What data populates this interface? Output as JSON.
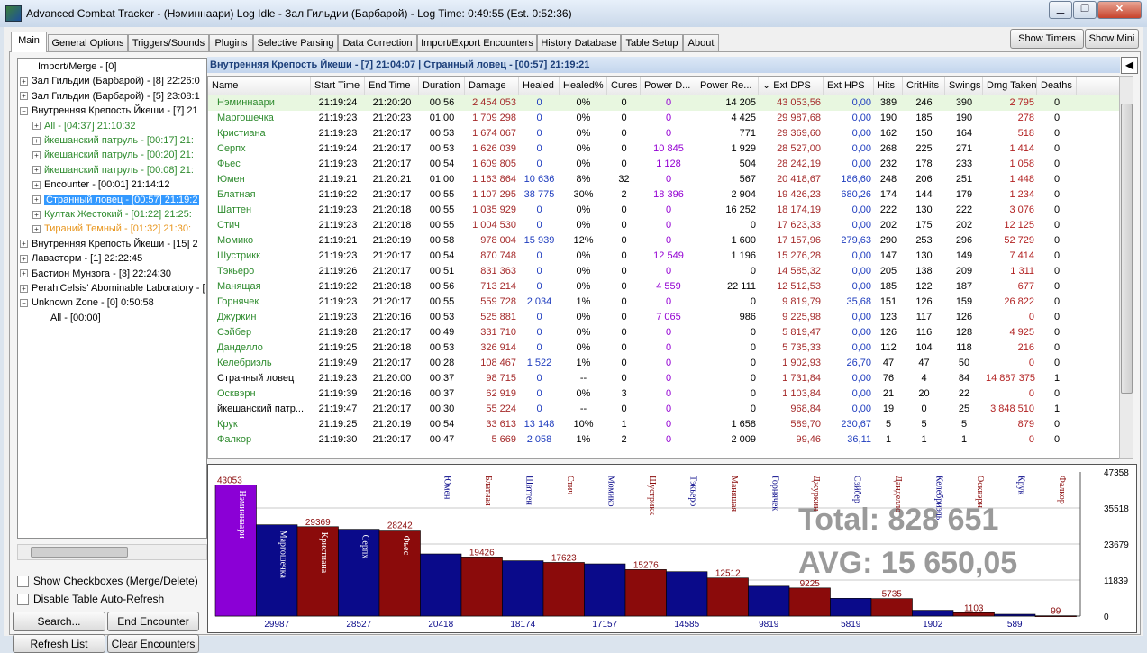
{
  "window": {
    "title": "Advanced Combat Tracker - (Нэминнаари) Log Idle - Зал Гильдии (Барбарой) - Log Time: 0:49:55 (Est. 0:52:36)",
    "min": "▁",
    "max": "❐",
    "close": "✕"
  },
  "tabs": [
    {
      "label": "Main"
    },
    {
      "label": "General Options"
    },
    {
      "label": "Triggers/Sounds"
    },
    {
      "label": "Plugins"
    },
    {
      "label": "Selective Parsing"
    },
    {
      "label": "Data Correction"
    },
    {
      "label": "Import/Export Encounters"
    },
    {
      "label": "History Database"
    },
    {
      "label": "Table Setup"
    },
    {
      "label": "About"
    }
  ],
  "top_buttons": {
    "show_timers": "Show Timers",
    "show_mini": "Show Mini"
  },
  "tree": [
    {
      "text": "Import/Merge - [0]",
      "level": 0,
      "expander": "",
      "color": "#000000"
    },
    {
      "text": "Зал Гильдии (Барбарой) - [8] 22:26:0",
      "level": 0,
      "expander": "+",
      "color": "#000000"
    },
    {
      "text": "Зал Гильдии (Барбарой) - [5] 23:08:1",
      "level": 0,
      "expander": "+",
      "color": "#000000"
    },
    {
      "text": "Внутренняя Крепость Йкеши - [7] 21",
      "level": 0,
      "expander": "−",
      "color": "#000000"
    },
    {
      "text": "All - [04:37] 21:10:32",
      "level": 1,
      "expander": "+",
      "color": "#2e8b2e"
    },
    {
      "text": "йкешанский патруль - [00:17] 21:",
      "level": 1,
      "expander": "+",
      "color": "#2e8b2e"
    },
    {
      "text": "йкешанский патруль - [00:20] 21:",
      "level": 1,
      "expander": "+",
      "color": "#2e8b2e"
    },
    {
      "text": "йкешанский патруль - [00:08] 21:",
      "level": 1,
      "expander": "+",
      "color": "#2e8b2e"
    },
    {
      "text": "Encounter - [00:01] 21:14:12",
      "level": 1,
      "expander": "+",
      "color": "#000000"
    },
    {
      "text": "Странный ловец - [00:57] 21:19:2",
      "level": 1,
      "expander": "+",
      "color": "#ffffff",
      "selected": true
    },
    {
      "text": "Култак Жестокий - [01:22] 21:25:",
      "level": 1,
      "expander": "+",
      "color": "#2e8b2e"
    },
    {
      "text": "Тираний Темный - [01:32] 21:30:",
      "level": 1,
      "expander": "+",
      "color": "#e8961e"
    },
    {
      "text": "Внутренняя Крепость Йкеши - [15] 2",
      "level": 0,
      "expander": "+",
      "color": "#000000"
    },
    {
      "text": "Лавасторм - [1] 22:22:45",
      "level": 0,
      "expander": "+",
      "color": "#000000"
    },
    {
      "text": "Бастион Мунзога - [3] 22:24:30",
      "level": 0,
      "expander": "+",
      "color": "#000000"
    },
    {
      "text": "Perah'Celsis' Abominable Laboratory - [",
      "level": 0,
      "expander": "+",
      "color": "#000000"
    },
    {
      "text": "Unknown Zone - [0] 0:50:58",
      "level": 0,
      "expander": "−",
      "color": "#000000"
    },
    {
      "text": "All - [00:00]",
      "level": 1,
      "expander": "",
      "color": "#000000"
    }
  ],
  "checks": {
    "show_checkboxes": "Show Checkboxes (Merge/Delete)",
    "disable_refresh": "Disable Table Auto-Refresh"
  },
  "buttons": {
    "search": "Search...",
    "end_encounter": "End Encounter",
    "refresh_list": "Refresh List",
    "clear_encounters": "Clear Encounters"
  },
  "encounter_header": "Внутренняя Крепость Йкеши - [7] 21:04:07  |  Странный ловец - [00:57] 21:19:21",
  "back_arrow": "◀",
  "table": {
    "columns": [
      "Name",
      "Start Time",
      "End Time",
      "Duration",
      "Damage",
      "Healed",
      "Healed%",
      "Cures",
      "Power D...",
      "Power Re...",
      "⌄ Ext DPS",
      "Ext HPS",
      "Hits",
      "CritHits",
      "Swings",
      "Dmg Taken",
      "Deaths"
    ],
    "rows": [
      [
        "Нэминнаари",
        "21:19:24",
        "21:20:20",
        "00:56",
        "2 454 053",
        "0",
        "0%",
        "0",
        "0",
        "14 205",
        "43 053,56",
        "0,00",
        "389",
        "246",
        "390",
        "2 795",
        "0"
      ],
      [
        "Маргошечка",
        "21:19:23",
        "21:20:23",
        "01:00",
        "1 709 298",
        "0",
        "0%",
        "0",
        "0",
        "4 425",
        "29 987,68",
        "0,00",
        "190",
        "185",
        "190",
        "278",
        "0"
      ],
      [
        "Кристиана",
        "21:19:23",
        "21:20:17",
        "00:53",
        "1 674 067",
        "0",
        "0%",
        "0",
        "0",
        "771",
        "29 369,60",
        "0,00",
        "162",
        "150",
        "164",
        "518",
        "0"
      ],
      [
        "Серпх",
        "21:19:24",
        "21:20:17",
        "00:53",
        "1 626 039",
        "0",
        "0%",
        "0",
        "10 845",
        "1 929",
        "28 527,00",
        "0,00",
        "268",
        "225",
        "271",
        "1 414",
        "0"
      ],
      [
        "Фьес",
        "21:19:23",
        "21:20:17",
        "00:54",
        "1 609 805",
        "0",
        "0%",
        "0",
        "1 128",
        "504",
        "28 242,19",
        "0,00",
        "232",
        "178",
        "233",
        "1 058",
        "0"
      ],
      [
        "Юмен",
        "21:19:21",
        "21:20:21",
        "01:00",
        "1 163 864",
        "10 636",
        "8%",
        "32",
        "0",
        "567",
        "20 418,67",
        "186,60",
        "248",
        "206",
        "251",
        "1 448",
        "0"
      ],
      [
        "Блатная",
        "21:19:22",
        "21:20:17",
        "00:55",
        "1 107 295",
        "38 775",
        "30%",
        "2",
        "18 396",
        "2 904",
        "19 426,23",
        "680,26",
        "174",
        "144",
        "179",
        "1 234",
        "0"
      ],
      [
        "Шаттен",
        "21:19:23",
        "21:20:18",
        "00:55",
        "1 035 929",
        "0",
        "0%",
        "0",
        "0",
        "16 252",
        "18 174,19",
        "0,00",
        "222",
        "130",
        "222",
        "3 076",
        "0"
      ],
      [
        "Стич",
        "21:19:23",
        "21:20:18",
        "00:55",
        "1 004 530",
        "0",
        "0%",
        "0",
        "0",
        "0",
        "17 623,33",
        "0,00",
        "202",
        "175",
        "202",
        "12 125",
        "0"
      ],
      [
        "Момико",
        "21:19:21",
        "21:20:19",
        "00:58",
        "978 004",
        "15 939",
        "12%",
        "0",
        "0",
        "1 600",
        "17 157,96",
        "279,63",
        "290",
        "253",
        "296",
        "52 729",
        "0"
      ],
      [
        "Шустрикк",
        "21:19:23",
        "21:20:17",
        "00:54",
        "870 748",
        "0",
        "0%",
        "0",
        "12 549",
        "1 196",
        "15 276,28",
        "0,00",
        "147",
        "130",
        "149",
        "7 414",
        "0"
      ],
      [
        "Тэкьеро",
        "21:19:26",
        "21:20:17",
        "00:51",
        "831 363",
        "0",
        "0%",
        "0",
        "0",
        "0",
        "14 585,32",
        "0,00",
        "205",
        "138",
        "209",
        "1 311",
        "0"
      ],
      [
        "Манящая",
        "21:19:22",
        "21:20:18",
        "00:56",
        "713 214",
        "0",
        "0%",
        "0",
        "4 559",
        "22 111",
        "12 512,53",
        "0,00",
        "185",
        "122",
        "187",
        "677",
        "0"
      ],
      [
        "Горнячек",
        "21:19:23",
        "21:20:17",
        "00:55",
        "559 728",
        "2 034",
        "1%",
        "0",
        "0",
        "0",
        "9 819,79",
        "35,68",
        "151",
        "126",
        "159",
        "26 822",
        "0"
      ],
      [
        "Джуркин",
        "21:19:23",
        "21:20:16",
        "00:53",
        "525 881",
        "0",
        "0%",
        "0",
        "7 065",
        "986",
        "9 225,98",
        "0,00",
        "123",
        "117",
        "126",
        "0",
        "0"
      ],
      [
        "Сэйбер",
        "21:19:28",
        "21:20:17",
        "00:49",
        "331 710",
        "0",
        "0%",
        "0",
        "0",
        "0",
        "5 819,47",
        "0,00",
        "126",
        "116",
        "128",
        "4 925",
        "0"
      ],
      [
        "Данделло",
        "21:19:25",
        "21:20:18",
        "00:53",
        "326 914",
        "0",
        "0%",
        "0",
        "0",
        "0",
        "5 735,33",
        "0,00",
        "112",
        "104",
        "118",
        "216",
        "0"
      ],
      [
        "Келебриэль",
        "21:19:49",
        "21:20:17",
        "00:28",
        "108 467",
        "1 522",
        "1%",
        "0",
        "0",
        "0",
        "1 902,93",
        "26,70",
        "47",
        "47",
        "50",
        "0",
        "0"
      ],
      [
        "Странный ловец",
        "21:19:23",
        "21:20:00",
        "00:37",
        "98 715",
        "0",
        "--",
        "0",
        "0",
        "0",
        "1 731,84",
        "0,00",
        "76",
        "4",
        "84",
        "14 887 375",
        "1"
      ],
      [
        "Осквэрн",
        "21:19:39",
        "21:20:16",
        "00:37",
        "62 919",
        "0",
        "0%",
        "3",
        "0",
        "0",
        "1 103,84",
        "0,00",
        "21",
        "20",
        "22",
        "0",
        "0"
      ],
      [
        "йкешанский патр...",
        "21:19:47",
        "21:20:17",
        "00:30",
        "55 224",
        "0",
        "--",
        "0",
        "0",
        "0",
        "968,84",
        "0,00",
        "19",
        "0",
        "25",
        "3 848 510",
        "1"
      ],
      [
        "Крук",
        "21:19:25",
        "21:20:19",
        "00:54",
        "33 613",
        "13 148",
        "10%",
        "1",
        "0",
        "1 658",
        "589,70",
        "230,67",
        "5",
        "5",
        "5",
        "879",
        "0"
      ],
      [
        "Фалкор",
        "21:19:30",
        "21:20:17",
        "00:47",
        "5 669",
        "2 058",
        "1%",
        "2",
        "0",
        "2 009",
        "99,46",
        "36,11",
        "1",
        "1",
        "1",
        "0",
        "0"
      ]
    ]
  },
  "chart": {
    "total": "Total:  828 651",
    "avg": "AVG:  15 650,05",
    "axis_right": [
      "47358",
      "35518",
      "23679",
      "11839",
      "0"
    ],
    "y_max": 47358,
    "colors": {
      "top": "#8b00d6",
      "blue": "#0a0a8a",
      "red": "#8b0b0b"
    }
  },
  "chart_data": {
    "type": "bar",
    "categories": [
      "Нэминнаари",
      "Маргошечка",
      "Кристиана",
      "Серпх",
      "Фьес",
      "Юмен",
      "Блатная",
      "Шаттен",
      "Стич",
      "Момико",
      "Шустрикк",
      "Тэкьеро",
      "Манящая",
      "Горнячек",
      "Джуркин",
      "Сэйбер",
      "Данделло",
      "Келебриэль",
      "Осквэрн",
      "Крук",
      "Фалкор"
    ],
    "values": [
      43053,
      29987,
      29369,
      28527,
      28242,
      20418,
      19426,
      18174,
      17623,
      17157,
      15276,
      14585,
      12512,
      9819,
      9225,
      5819,
      5735,
      1902,
      1103,
      589,
      99
    ],
    "value_labels": [
      "43053",
      "29987",
      "29369",
      "28527",
      "28242",
      "20418",
      "19426",
      "18174",
      "17623",
      "17157",
      "15276",
      "14585",
      "12512",
      "9819",
      "9225",
      "5819",
      "5735",
      "1902",
      "1103",
      "589",
      "99"
    ],
    "ylim": [
      0,
      47358
    ]
  }
}
